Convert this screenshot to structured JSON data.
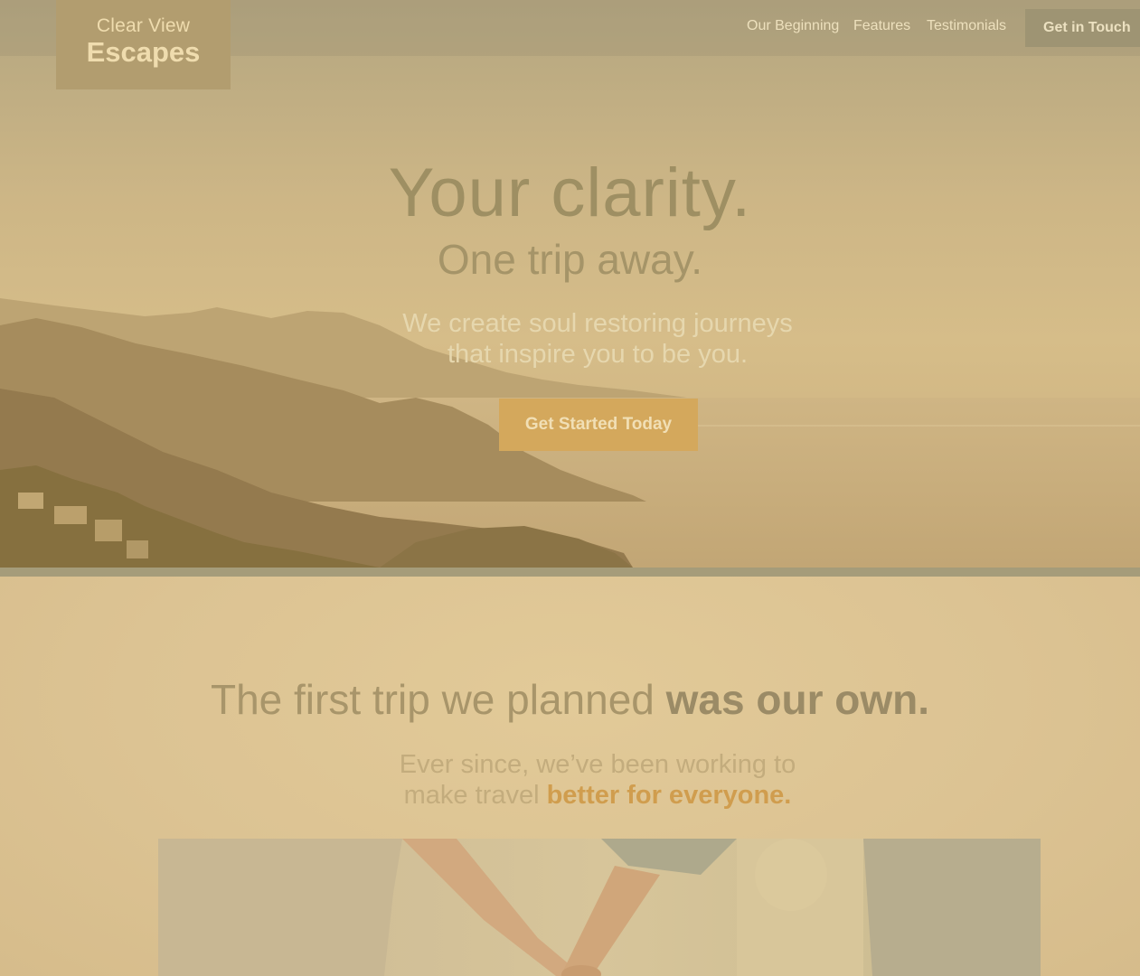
{
  "brand": {
    "name_line1": "Clear View",
    "name_line2": "Escapes"
  },
  "nav": {
    "links": [
      "Our Beginning",
      "Features",
      "Testimonials"
    ],
    "cta_label": "Get in Touch"
  },
  "hero": {
    "title": "Your clarity.",
    "subtitle": "One trip away.",
    "tagline_line1": "We create soul restoring journeys",
    "tagline_line2": "that inspire you to be you.",
    "button_label": "Get Started Today"
  },
  "story": {
    "heading_light": "The first trip we planned ",
    "heading_bold": "was our own.",
    "text_line1": "Ever since, we’ve been working to",
    "text_line2_plain": "make travel ",
    "text_line2_accent": "better for everyone."
  },
  "colors": {
    "overlay_tint": "#d9bf8a",
    "accent": "#d4a85c",
    "nav_cta_bg": "#9e9473",
    "logo_bg": "#b29d6f"
  },
  "icons": {
    "hero_image": "coastal-mountains-photo",
    "story_image": "couple-holding-hands-photo"
  }
}
